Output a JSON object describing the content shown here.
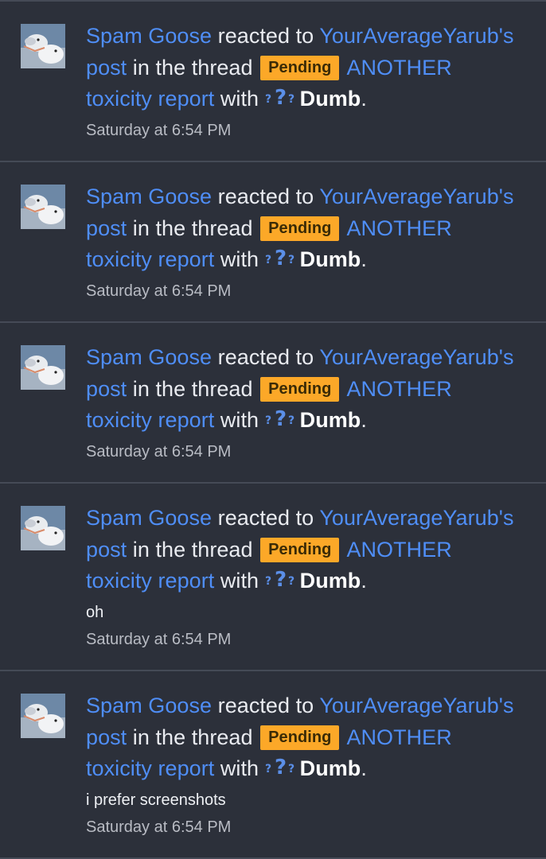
{
  "alerts": [
    {
      "actor": "Spam Goose",
      "verb": "reacted to",
      "author_post": "YourAverageYarub's",
      "post_word": "post",
      "in_thread": "in the thread",
      "prefix": "Pending",
      "thread_line1": "ANOTHER",
      "thread_line2": "toxicity report",
      "with": "with",
      "reaction": "Dumb",
      "period": ".",
      "message": "",
      "time": "Saturday at 6:54 PM"
    },
    {
      "actor": "Spam Goose",
      "verb": "reacted to",
      "author_post": "YourAverageYarub's",
      "post_word": "post",
      "in_thread": "in the thread",
      "prefix": "Pending",
      "thread_line1": "ANOTHER",
      "thread_line2": "toxicity report",
      "with": "with",
      "reaction": "Dumb",
      "period": ".",
      "message": "",
      "time": "Saturday at 6:54 PM"
    },
    {
      "actor": "Spam Goose",
      "verb": "reacted to",
      "author_post": "YourAverageYarub's",
      "post_word": "post",
      "in_thread": "in the thread",
      "prefix": "Pending",
      "thread_line1": "ANOTHER",
      "thread_line2": "toxicity report",
      "with": "with",
      "reaction": "Dumb",
      "period": ".",
      "message": "",
      "time": "Saturday at 6:54 PM"
    },
    {
      "actor": "Spam Goose",
      "verb": "reacted to",
      "author_post": "YourAverageYarub's",
      "post_word": "post",
      "in_thread": "in the thread",
      "prefix": "Pending",
      "thread_line1": "ANOTHER",
      "thread_line2": "toxicity report",
      "with": "with",
      "reaction": "Dumb",
      "period": ".",
      "message": "oh",
      "time": "Saturday at 6:54 PM"
    },
    {
      "actor": "Spam Goose",
      "verb": "reacted to",
      "author_post": "YourAverageYarub's",
      "post_word": "post",
      "in_thread": "in the thread",
      "prefix": "Pending",
      "thread_line1": "ANOTHER",
      "thread_line2": "toxicity report",
      "with": "with",
      "reaction": "Dumb",
      "period": ".",
      "message": "i prefer screenshots",
      "time": "Saturday at 6:54 PM"
    }
  ],
  "reaction_icon": "question-marks-icon",
  "avatar_icon": "goose-avatar",
  "colors": {
    "background": "#2c303a",
    "divider": "#454a56",
    "link": "#4f8ef7",
    "badge": "#fca828",
    "time": "#b9bcc4"
  }
}
